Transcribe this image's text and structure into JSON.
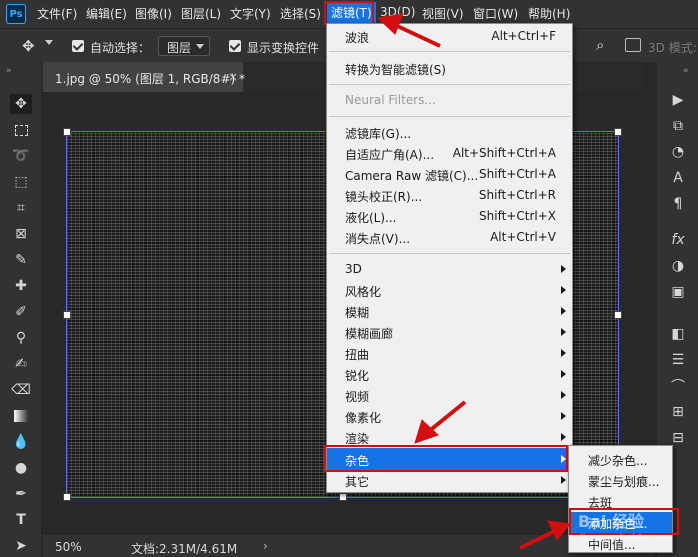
{
  "app": {
    "logo": "Ps"
  },
  "menubar": {
    "items": [
      "文件(F)",
      "编辑(E)",
      "图像(I)",
      "图层(L)",
      "文字(Y)",
      "选择(S)",
      "滤镜(T)",
      "3D(D)",
      "视图(V)",
      "窗口(W)",
      "帮助(H)"
    ],
    "active": "滤镜(T)"
  },
  "options_bar": {
    "auto_select_label": "自动选择：",
    "auto_select_value": "图层",
    "show_transform_label": "显示变换控件",
    "mode_3d_label": "3D 模式:"
  },
  "document": {
    "tab_title": "1.jpg @ 50% (图层 1, RGB/8#) *",
    "close_glyph": "×"
  },
  "status_bar": {
    "zoom": "50%",
    "doc_size": "文档:2.31M/4.61M",
    "arrow": "›"
  },
  "filter_menu": {
    "items": [
      {
        "label": "波浪",
        "shortcut": "Alt+Ctrl+F"
      },
      {
        "label": "转换为智能滤镜(S)"
      },
      {
        "label": "Neural Filters...",
        "disabled": true
      },
      {
        "label": "滤镜库(G)..."
      },
      {
        "label": "自适应广角(A)...",
        "shortcut": "Alt+Shift+Ctrl+A"
      },
      {
        "label": "Camera Raw 滤镜(C)...",
        "shortcut": "Shift+Ctrl+A"
      },
      {
        "label": "镜头校正(R)...",
        "shortcut": "Shift+Ctrl+R"
      },
      {
        "label": "液化(L)...",
        "shortcut": "Shift+Ctrl+X"
      },
      {
        "label": "消失点(V)...",
        "shortcut": "Alt+Ctrl+V"
      },
      {
        "label": "3D",
        "submenu": true
      },
      {
        "label": "风格化",
        "submenu": true
      },
      {
        "label": "模糊",
        "submenu": true
      },
      {
        "label": "模糊画廊",
        "submenu": true
      },
      {
        "label": "扭曲",
        "submenu": true
      },
      {
        "label": "锐化",
        "submenu": true
      },
      {
        "label": "视频",
        "submenu": true
      },
      {
        "label": "像素化",
        "submenu": true
      },
      {
        "label": "渲染",
        "submenu": true
      },
      {
        "label": "杂色",
        "submenu": true,
        "highlighted": true
      },
      {
        "label": "其它",
        "submenu": true
      }
    ]
  },
  "noise_submenu": {
    "items": [
      {
        "label": "减少杂色..."
      },
      {
        "label": "蒙尘与划痕..."
      },
      {
        "label": "去斑"
      },
      {
        "label": "添加杂色...",
        "highlighted": true
      },
      {
        "label": "中间值..."
      }
    ]
  },
  "watermark": {
    "brand": "Bai 经验",
    "url": "jingyan.baidu.com"
  },
  "colors": {
    "accent": "#1473e6",
    "annotation": "#d40e0e",
    "menu_bg": "#f0f0f0",
    "ui_bg": "#323232"
  }
}
